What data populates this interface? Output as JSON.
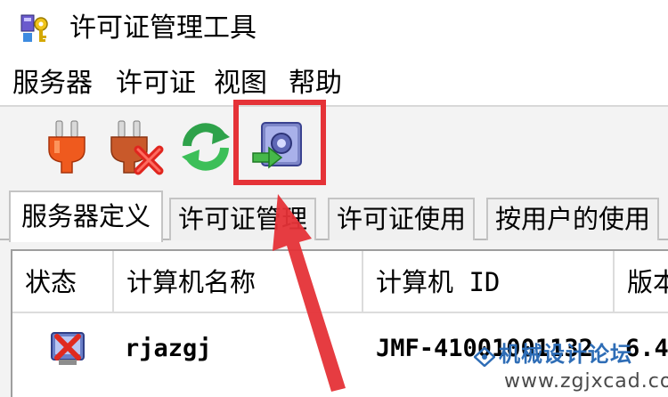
{
  "window": {
    "title": "许可证管理工具",
    "app_icon": "license-tool-icon"
  },
  "menu": [
    "服务器",
    "许可证",
    "视图",
    "帮助"
  ],
  "toolbar": {
    "buttons": [
      {
        "name": "connect-server",
        "icon": "plug-icon"
      },
      {
        "name": "disconnect-server",
        "icon": "plug-remove-icon"
      },
      {
        "name": "refresh",
        "icon": "refresh-icon"
      },
      {
        "name": "license-import",
        "icon": "license-import-icon"
      }
    ],
    "highlighted": "license-import"
  },
  "tabs": [
    {
      "label": "服务器定义",
      "active": true
    },
    {
      "label": "许可证管理",
      "active": false
    },
    {
      "label": "许可证使用",
      "active": false
    },
    {
      "label": "按用户的使用",
      "active": false
    }
  ],
  "table": {
    "columns": [
      "状态",
      "计算机名称",
      "计算机 ID",
      "版本"
    ],
    "rows": [
      {
        "status_icon": "server-error-icon",
        "computer_name": "rjazgj",
        "computer_id": "JMF-41001001132",
        "version": "6.4"
      }
    ]
  },
  "annotation": {
    "arrow": "red-arrow",
    "color": "#e53237"
  },
  "watermark": {
    "text": "机械设计论坛",
    "url": "www.zgjxcad.com"
  }
}
